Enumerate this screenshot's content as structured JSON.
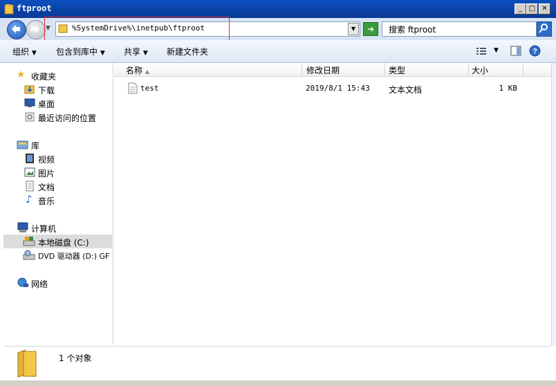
{
  "window": {
    "title": "ftproot"
  },
  "address": {
    "path": "%SystemDrive%\\inetpub\\ftproot",
    "search_placeholder": "搜索 ftproot"
  },
  "toolbar": {
    "organize": "组织",
    "include_in_library": "包含到库中",
    "share": "共享",
    "new_folder": "新建文件夹"
  },
  "sidebar": {
    "favorites": {
      "label": "收藏夹",
      "items": [
        "下载",
        "桌面",
        "最近访问的位置"
      ]
    },
    "libraries": {
      "label": "库",
      "items": [
        "视频",
        "图片",
        "文档",
        "音乐"
      ]
    },
    "computer": {
      "label": "计算机",
      "items": [
        "本地磁盘 (C:)",
        "DVD 驱动器 (D:) GF"
      ]
    },
    "network": {
      "label": "网络"
    }
  },
  "columns": [
    "名称",
    "修改日期",
    "类型",
    "大小"
  ],
  "files": [
    {
      "name": "test",
      "modified": "2019/8/1 15:43",
      "type": "文本文档",
      "size": "1 KB"
    }
  ],
  "status": {
    "count_text": "1 个对象"
  },
  "colors": {
    "title_bar": "#0a3a96",
    "address_bar": "#d8e4f3",
    "highlight_box": "#e03030"
  }
}
